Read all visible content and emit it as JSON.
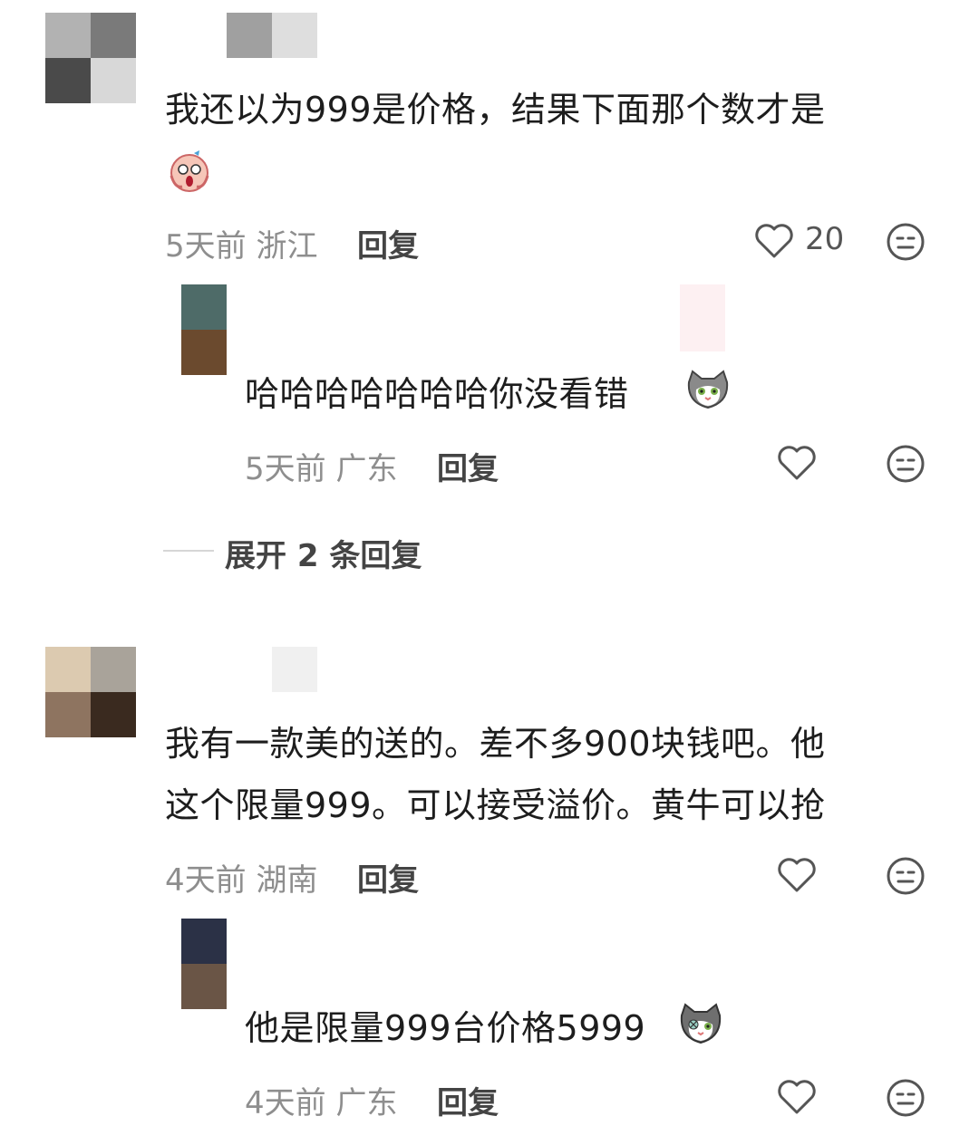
{
  "comments": [
    {
      "text_lines": [
        "我还以为999是价格，结果下面那个数才是"
      ],
      "emoji": "scream-emoji",
      "time": "5天前",
      "location": "浙江",
      "reply_label": "回复",
      "like_count": "20",
      "avatar_colors": [
        "#b2b2b2",
        "#7a7a7a",
        "#4a4a4a",
        "#d8d8d8"
      ],
      "name_block_colors": [
        "#a0a0a0",
        "#dedede"
      ],
      "replies": [
        {
          "text": "哈哈哈哈哈哈哈你没看错",
          "emoji": "cat-emoji",
          "time": "5天前",
          "location": "广东",
          "reply_label": "回复",
          "avatar_colors": [
            "#4e6b68",
            "#6b4a2e"
          ]
        }
      ],
      "expand_label": "展开 2 条回复"
    },
    {
      "text_lines": [
        "我有一款美的送的。差不多900块钱吧。他",
        "这个限量999。可以接受溢价。黄牛可以抢"
      ],
      "time": "4天前",
      "location": "湖南",
      "reply_label": "回复",
      "avatar_colors": [
        "#dccab0",
        "#a9a39a",
        "#8e7460",
        "#3a2a1f"
      ],
      "name_block_colors": [
        "#f0f0f0"
      ],
      "replies": [
        {
          "text": "他是限量999台价格5999",
          "emoji": "cat-emoji",
          "time": "4天前",
          "location": "广东",
          "reply_label": "回复",
          "avatar_colors": [
            "#2b3146",
            "#6a5546"
          ]
        }
      ]
    }
  ]
}
